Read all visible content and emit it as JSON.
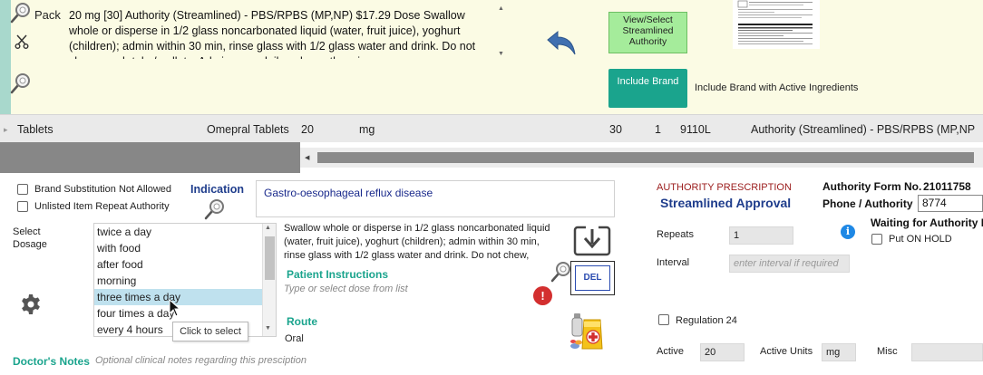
{
  "drug_panel": {
    "pack_label": "Pack",
    "drug_description": "20 mg [30] Authority (Streamlined) - PBS/RPBS (MP,NP) $17.29 Dose Swallow whole or disperse in 1/2 glass noncarbonated liquid (water, fruit juice), yoghurt (children); admin within 30 min, rinse glass with 1/2 glass water and drink. Do not chew, crush tabs/ pellets. Admin once daily unless otherwise",
    "view_select_label": "View/Select Streamlined Authority",
    "include_brand_label": "Include Brand",
    "include_brand_text": "Include Brand with Active Ingredients",
    "icons": {
      "magnifier": "magnifier-icon",
      "scissors": "scissors-icon",
      "back": "back-arrow-icon",
      "document": "document-thumbnail"
    }
  },
  "grid_row": {
    "form": "Tablets",
    "brand": "Omepral Tablets",
    "strength": "20",
    "unit": "mg",
    "quantity": "30",
    "repeats": "1",
    "item_code": "9110L",
    "authority": "Authority (Streamlined) - PBS/RPBS (MP,NP"
  },
  "options": {
    "brand_substitution": "Brand Substitution Not Allowed",
    "unlisted_item": "Unlisted Item Repeat Authority"
  },
  "indication": {
    "label": "Indication",
    "value": "Gastro-oesophageal reflux disease"
  },
  "dosage": {
    "label_line1": "Select",
    "label_line2": "Dosage",
    "items": [
      "twice a day",
      "with food",
      "after food",
      "morning",
      "three times a day",
      "four times a day",
      "every 4 hours"
    ],
    "selected_index": 4,
    "tooltip": "Click to select"
  },
  "patient_instructions": {
    "text": "Swallow whole or disperse in 1/2 glass noncarbonated liquid (water, fruit juice), yoghurt (children); admin within 30 min, rinse glass with 1/2 glass water and drink. Do not chew,",
    "label": "Patient Instructions",
    "placeholder": "Type or select dose from list",
    "del_label": "DEL"
  },
  "route": {
    "label": "Route",
    "value": "Oral"
  },
  "doctors_notes": {
    "label": "Doctor's Notes",
    "placeholder": "Optional clinical notes regarding this presciption"
  },
  "authority": {
    "header": "AUTHORITY PRESCRIPTION",
    "approval_type": "Streamlined Approval",
    "form_no_label": "Authority Form No.",
    "form_no_value": "21011758",
    "phone_label": "Phone / Authority",
    "phone_value": "8774",
    "waiting_label": "Waiting for Authority N",
    "on_hold_label": "Put ON HOLD"
  },
  "prescription_fields": {
    "repeats_label": "Repeats",
    "repeats_value": "1",
    "interval_label": "Interval",
    "interval_placeholder": "enter interval if required",
    "regulation_label": "Regulation 24",
    "active_label": "Active",
    "active_value": "20",
    "active_units_label": "Active Units",
    "active_units_value": "mg",
    "misc_label": "Misc"
  },
  "colors": {
    "teal_accent": "#1aa48d",
    "navy_title": "#1f3d8c",
    "authority_red": "#9b1c1c",
    "view_select_green": "#a5ec9b",
    "panel_yellow": "#fbfbe4"
  }
}
